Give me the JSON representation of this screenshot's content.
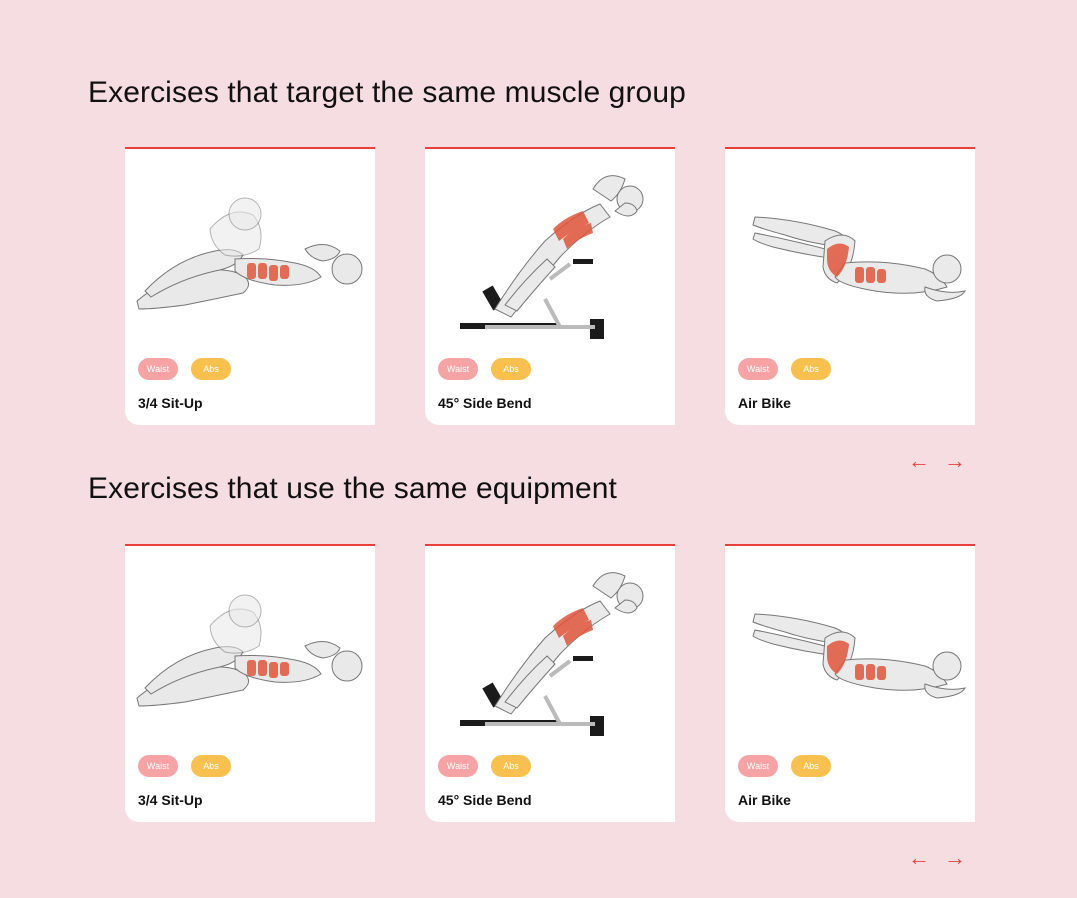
{
  "sections": [
    {
      "title": "Exercises that target the same muscle group",
      "cards": [
        {
          "name": "3/4 Sit-Up",
          "tags": [
            "Waist",
            "Abs"
          ]
        },
        {
          "name": "45° Side Bend",
          "tags": [
            "Waist",
            "Abs"
          ]
        },
        {
          "name": "Air Bike",
          "tags": [
            "Waist",
            "Abs"
          ]
        }
      ],
      "nav": {
        "prev": "←",
        "next": "→"
      }
    },
    {
      "title": "Exercises that use the same equipment",
      "cards": [
        {
          "name": "3/4 Sit-Up",
          "tags": [
            "Waist",
            "Abs"
          ]
        },
        {
          "name": "45° Side Bend",
          "tags": [
            "Waist",
            "Abs"
          ]
        },
        {
          "name": "Air Bike",
          "tags": [
            "Waist",
            "Abs"
          ]
        }
      ],
      "nav": {
        "prev": "←",
        "next": "→"
      }
    }
  ],
  "colors": {
    "background": "#f5dde1",
    "accent": "#e8403a",
    "tag_waist": "#f6a3a6",
    "tag_abs": "#f8c04e"
  }
}
